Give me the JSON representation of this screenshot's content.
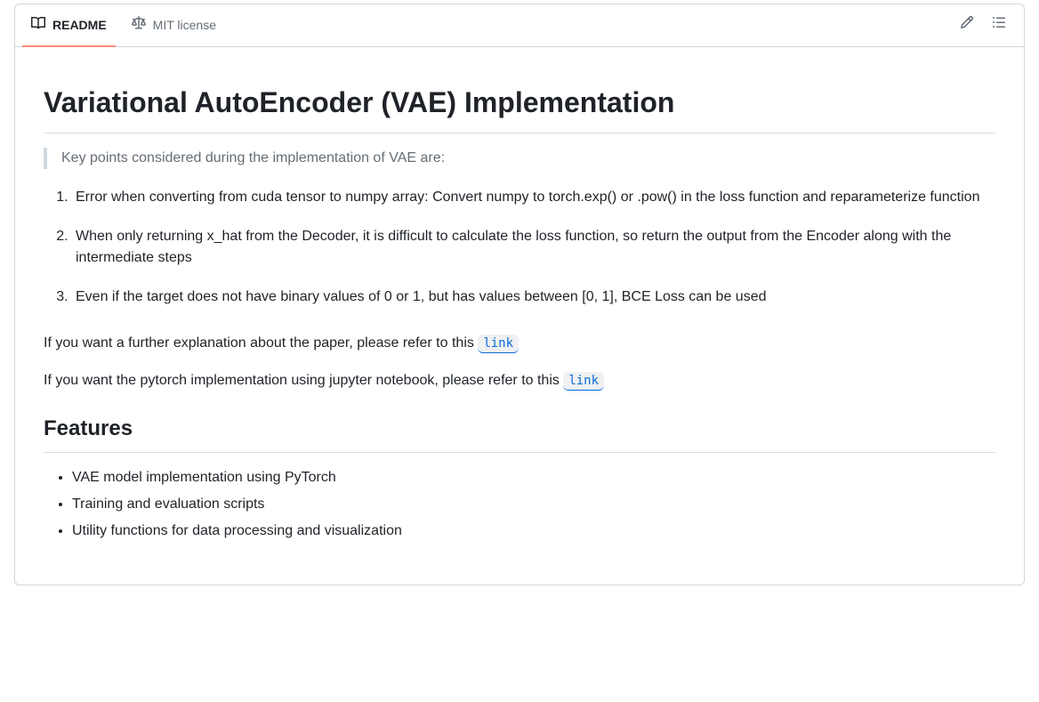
{
  "tabs": {
    "readme": "README",
    "license": "MIT license"
  },
  "heading": "Variational AutoEncoder (VAE) Implementation",
  "blockquote": "Key points considered during the implementation of VAE are:",
  "keypoints": [
    "Error when converting from cuda tensor to numpy array: Convert numpy to torch.exp() or .pow() in the loss function and reparameterize function",
    "When only returning x_hat from the Decoder, it is difficult to calculate the loss function, so return the output from the Encoder along with the intermediate steps",
    "Even if the target does not have binary values of 0 or 1, but has values between [0, 1], BCE Loss can be used"
  ],
  "para1_pre": "If you want a further explanation about the paper, please refer to this ",
  "para2_pre": "If you want the pytorch implementation using jupyter notebook, please refer to this ",
  "link_label": "link",
  "features_heading": "Features",
  "features": [
    "VAE model implementation using PyTorch",
    "Training and evaluation scripts",
    "Utility functions for data processing and visualization"
  ]
}
